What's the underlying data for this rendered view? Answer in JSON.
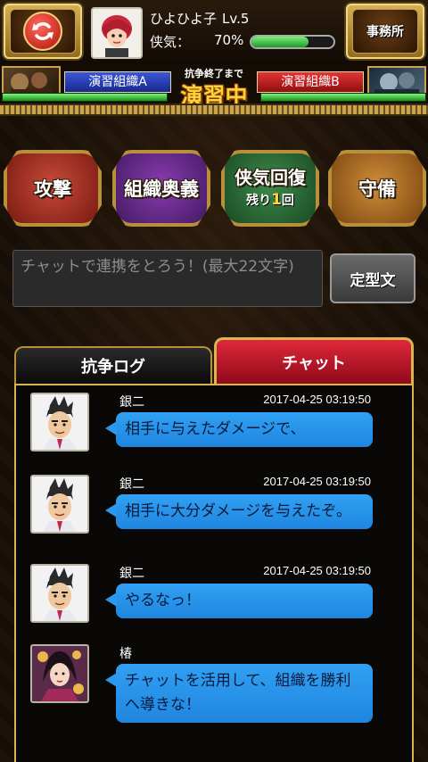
{
  "header": {
    "player_name": "ひよひよ子",
    "player_level": "Lv.5",
    "kyoki_label": "侠気：",
    "kyoki_value": "70%",
    "kyoki_fraction": 0.7,
    "refresh_icon": "refresh-icon",
    "office_label": "事務所"
  },
  "versus": {
    "team_a": "演習組織A",
    "team_b": "演習組織B",
    "end_label": "抗争終了まで",
    "status": "演習中",
    "team_a_hp_fraction": 1.0,
    "team_b_hp_fraction": 1.0,
    "team_a_color": "#2a3fc0",
    "team_b_color": "#c41818"
  },
  "actions": {
    "attack": "攻撃",
    "secret": "組織奥義",
    "recover": "侠気回復",
    "remain_prefix": "残り",
    "remain_count": "1",
    "remain_suffix": "回",
    "defend": "守備"
  },
  "chat_input": {
    "placeholder": "チャットで連携をとろう！(最大22文字)",
    "template_button": "定型文"
  },
  "tabs": {
    "log": "抗争ログ",
    "chat": "チャット",
    "active": "chat"
  },
  "messages": [
    {
      "name": "銀二",
      "time": "2017-04-25 03:19:50",
      "text": "相手に与えたダメージで、"
    },
    {
      "name": "銀二",
      "time": "2017-04-25 03:19:50",
      "text": "相手に大分ダメージを与えたぞ。"
    },
    {
      "name": "銀二",
      "time": "2017-04-25 03:19:50",
      "text": "やるなっ！"
    },
    {
      "name": "椿",
      "time": "",
      "text": "チャットを活用して、組織を勝利へ導きな！"
    }
  ],
  "colors": {
    "accent_gold": "#d9b552",
    "bubble_blue": "#2a98ee",
    "status_yellow": "#ffd23a"
  }
}
